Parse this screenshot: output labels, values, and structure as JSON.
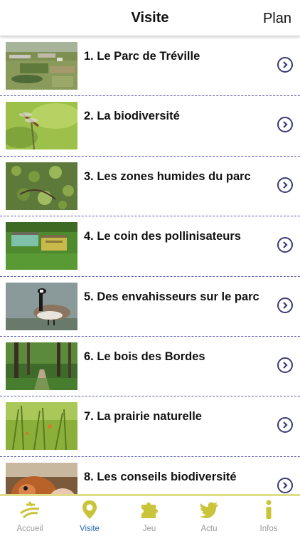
{
  "header": {
    "title": "Visite",
    "plan_label": "Plan"
  },
  "items": [
    {
      "label": "1. Le Parc de Tréville",
      "image": "park-aerial-photo"
    },
    {
      "label": "2. La biodiversité",
      "image": "dragonfly-photo"
    },
    {
      "label": "3. Les zones humides du parc",
      "image": "wetland-photo"
    },
    {
      "label": "4. Le coin des pollinisateurs",
      "image": "beehives-photo"
    },
    {
      "label": "5. Des envahisseurs sur le parc",
      "image": "canada-goose-photo"
    },
    {
      "label": "6. Le bois des Bordes",
      "image": "forest-path-photo"
    },
    {
      "label": "7. La prairie naturelle",
      "image": "meadow-photo"
    },
    {
      "label": "8. Les conseils biodiversité",
      "image": "squirrel-photo"
    }
  ],
  "tabs": [
    {
      "label": "Accueil",
      "icon": "home-logo-icon"
    },
    {
      "label": "Visite",
      "icon": "map-pin-icon",
      "active": true
    },
    {
      "label": "Jeu",
      "icon": "puzzle-icon"
    },
    {
      "label": "Actu",
      "icon": "twitter-bird-icon"
    },
    {
      "label": "Infos",
      "icon": "info-icon"
    }
  ],
  "colors": {
    "accent": "#c9c43a",
    "active": "#2a6db0",
    "chevron": "#3a3a75"
  }
}
